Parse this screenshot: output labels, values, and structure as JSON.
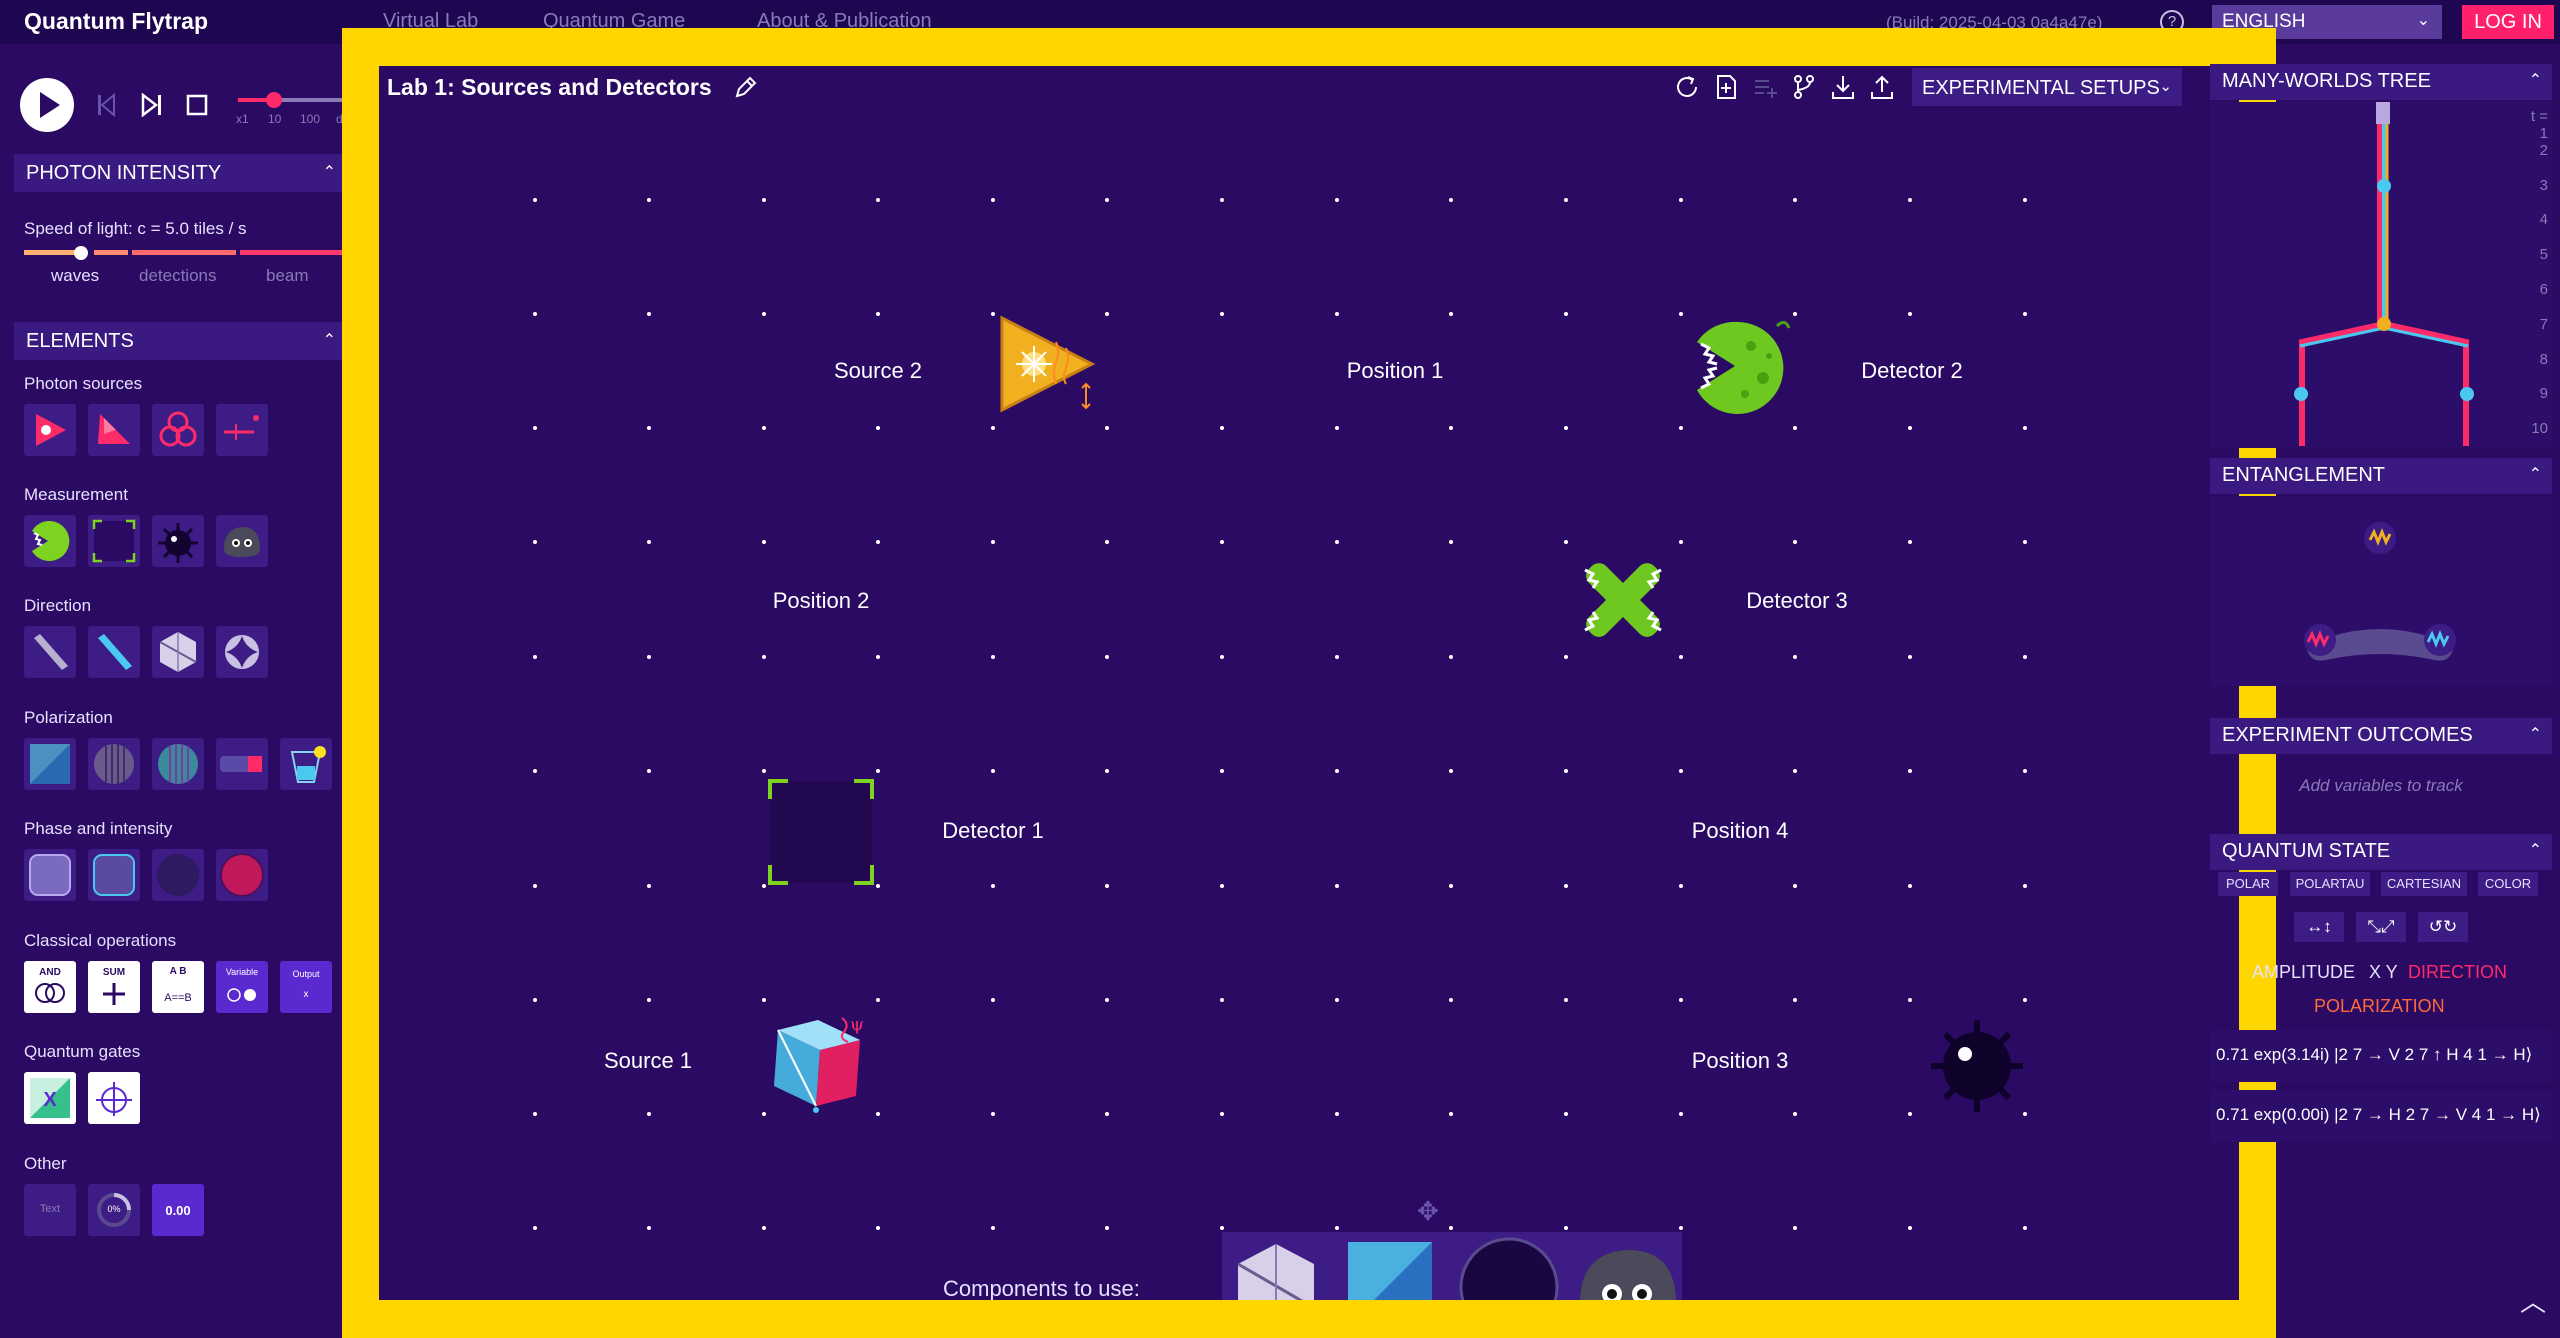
{
  "topbar": {
    "brand": "Quantum Flytrap",
    "nav": [
      "Virtual Lab",
      "Quantum Game",
      "About & Publication"
    ],
    "build": "(Build: 2025-04-03 0a4a47e)",
    "help": "?",
    "language": "ENGLISH",
    "login": "LOG IN"
  },
  "playback": {
    "speed_labels": [
      "x1",
      "10",
      "100",
      "d"
    ]
  },
  "photon_intensity": {
    "title": "PHOTON INTENSITY",
    "speed_text": "Speed of light: c = 5.0 tiles / s",
    "modes": [
      "waves",
      "detections",
      "beam"
    ],
    "active_mode": "waves"
  },
  "elements": {
    "title": "ELEMENTS",
    "groups": [
      {
        "title": "Photon sources",
        "items": [
          "laser-icon",
          "polarized-source-icon",
          "entangled-source-icon",
          "pulsed-source-icon"
        ]
      },
      {
        "title": "Measurement",
        "items": [
          "flytrap-detector-icon",
          "camera-detector-icon",
          "mine-icon",
          "rock-icon"
        ]
      },
      {
        "title": "Direction",
        "items": [
          "mirror-icon",
          "beam-splitter-icon",
          "polarizing-beam-splitter-icon",
          "corner-cube-icon"
        ]
      },
      {
        "title": "Polarization",
        "items": [
          "polarizer-icon",
          "vertical-polarizer-icon",
          "quarter-wave-plate-icon",
          "faraday-rotator-icon",
          "sugar-solution-icon"
        ]
      },
      {
        "title": "Phase and intensity",
        "items": [
          "phase-plate-icon",
          "phase-plate-tunable-icon",
          "absorber-icon",
          "filter-icon"
        ]
      },
      {
        "title": "Classical operations",
        "items": [
          "and-gate-icon",
          "sum-gate-icon",
          "comparator-icon",
          "variable-icon",
          "output-icon"
        ],
        "labels": [
          "AND",
          "SUM",
          "A B",
          "Variable",
          "Output"
        ]
      },
      {
        "title": "Quantum gates",
        "items": [
          "x-gate-icon",
          "cnot-gate-icon"
        ]
      },
      {
        "title": "Other",
        "items": [
          "text-box-icon",
          "counter-icon",
          "value-display-icon"
        ],
        "labels": [
          "Text",
          "0%",
          "0.00"
        ]
      }
    ]
  },
  "lab": {
    "title": "Lab 1: Sources and Detectors",
    "experimental_setups": "EXPERIMENTAL SETUPS",
    "cells": {
      "source2": "Source 2",
      "position1": "Position 1",
      "detector2": "Detector 2",
      "position2": "Position 2",
      "detector3": "Detector 3",
      "detector1": "Detector 1",
      "position4": "Position 4",
      "source1": "Source 1",
      "position3": "Position 3"
    },
    "components_label": "Components to use:"
  },
  "right": {
    "tree_title": "MANY-WORLDS TREE",
    "tree_steps": [
      "t = 1",
      "2",
      "3",
      "4",
      "5",
      "6",
      "7",
      "8",
      "9",
      "10"
    ],
    "entanglement_title": "ENTANGLEMENT",
    "outcomes_title": "EXPERIMENT OUTCOMES",
    "outcomes_hint": "Add variables to track",
    "state_title": "QUANTUM STATE",
    "state_tabs": [
      "POLAR",
      "POLARTAU",
      "CARTESIAN",
      "COLOR"
    ],
    "state_labels": {
      "amplitude": "AMPLITUDE",
      "xy": "X Y",
      "direction": "DIRECTION",
      "polarization": "POLARIZATION"
    },
    "state_rows": [
      "0.71 exp(3.14i) |2 7 → V 2 7 ↑ H 4 1 → H⟩",
      "0.71 exp(0.00i) |2 7 → H 2 7 → V 4 1 → H⟩"
    ],
    "colors": {
      "accent": "#ff1f6a",
      "direction": "#ff2a68",
      "polarization": "#ff6a3c",
      "highlight": "#ffd600"
    }
  }
}
